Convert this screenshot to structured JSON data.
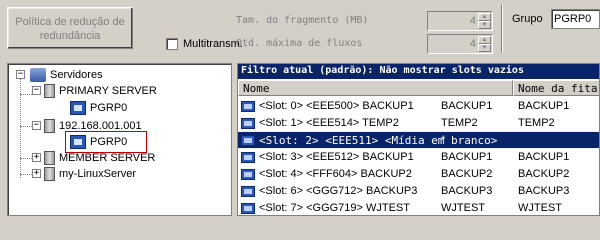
{
  "toolbar": {
    "policy_button": "Política de redução de redundância",
    "multi_label": "Multitransm.",
    "frag_label": "Tam. do fragmento (MB)",
    "frag_value": "4",
    "streams_label": "Qtd. máxima de fluxos",
    "streams_value": "4",
    "group_label": "Grupo",
    "group_value": "PGRP0"
  },
  "tree": {
    "root": "Servidores",
    "primary": "PRIMARY SERVER",
    "primary_child": "PGRP0",
    "ip": "192.168.001.001",
    "ip_child": "PGRP0",
    "member": "MEMBER SERVER",
    "linux": "my-LinuxServer"
  },
  "slots": {
    "filter": "Filtro atual (padrão): Não mostrar slots vazios",
    "col_name": "Nome",
    "col_name2": "Nome da fita",
    "rows": [
      {
        "name": "<Slot: 0> <EEE500> BACKUP1",
        "c2": "BACKUP1",
        "c3": "BACKUP1"
      },
      {
        "name": "<Slot: 1> <EEE514> TEMP2",
        "c2": "TEMP2",
        "c3": "TEMP2"
      },
      {
        "name": "<Slot: 2> <EEE511> <Mídia em branco>",
        "c2": "*",
        "c3": ""
      },
      {
        "name": "<Slot: 3> <EEE512> BACKUP1",
        "c2": "BACKUP1",
        "c3": "BACKUP1"
      },
      {
        "name": "<Slot: 4> <FFF604> BACKUP2",
        "c2": "BACKUP2",
        "c3": "BACKUP2"
      },
      {
        "name": "<Slot: 6> <GGG712> BACKUP3",
        "c2": "BACKUP3",
        "c3": "BACKUP3"
      },
      {
        "name": "<Slot: 7> <GGG719> WJTEST",
        "c2": "WJTEST",
        "c3": "WJTEST"
      }
    ]
  }
}
